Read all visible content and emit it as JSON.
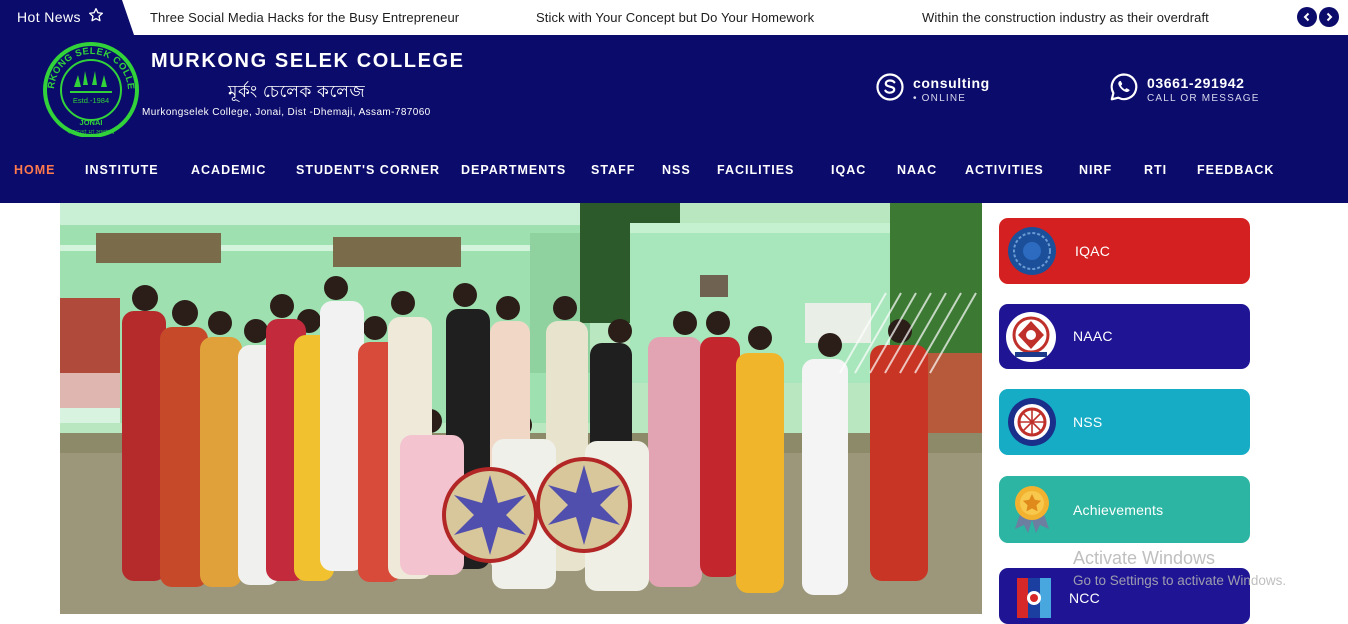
{
  "ticker": {
    "label": "Hot News",
    "items": [
      "Three Social Media Hacks for the Busy Entrepreneur",
      "Stick with Your Concept but Do Your Homework",
      "Within the construction industry as their overdraft"
    ]
  },
  "header": {
    "college_name": "MURKONG SELEK COLLEGE",
    "college_name_local": "মূৰ্কং চেলেক কলেজ",
    "address": "Murkongselek College, Jonai, Dist -Dhemaji, Assam-787060",
    "logo_text": {
      "ring": "MURKONG SELEK COLLEGE",
      "estd": "Estd.-1984",
      "place": "JONAI",
      "motto": "অসতো মা সদ্গময়"
    },
    "contacts": [
      {
        "icon": "skype-icon",
        "main": "consulting",
        "sub": "• ONLINE"
      },
      {
        "icon": "whatsapp-icon",
        "main": "03661-291942",
        "sub": "CALL OR MESSAGE"
      }
    ]
  },
  "nav": [
    "HOME",
    "INSTITUTE",
    "ACADEMIC",
    "STUDENT'S CORNER",
    "DEPARTMENTS",
    "STAFF",
    "NSS",
    "FACILITIES",
    "IQAC",
    "NAAC",
    "ACTIVITIES",
    "NIRF",
    "RTI",
    "FEEDBACK"
  ],
  "sidebar": [
    {
      "label": "IQAC",
      "icon": "iqac-logo-icon",
      "color": "#d42020"
    },
    {
      "label": "NAAC",
      "icon": "naac-logo-icon",
      "color": "#1f1494"
    },
    {
      "label": "NSS",
      "icon": "nss-logo-icon",
      "color": "#16acc6"
    },
    {
      "label": "Achievements",
      "icon": "medal-icon",
      "color": "#2bb5a2"
    },
    {
      "label": "NCC",
      "icon": "ncc-logo-icon",
      "color": "#1f1494"
    }
  ],
  "watermark": {
    "title": "Activate Windows",
    "subtitle": "Go to Settings to activate Windows."
  },
  "colors": {
    "navy": "#0b0b6b",
    "nav_active": "#ff7a4d",
    "logo_green": "#31d23a"
  }
}
